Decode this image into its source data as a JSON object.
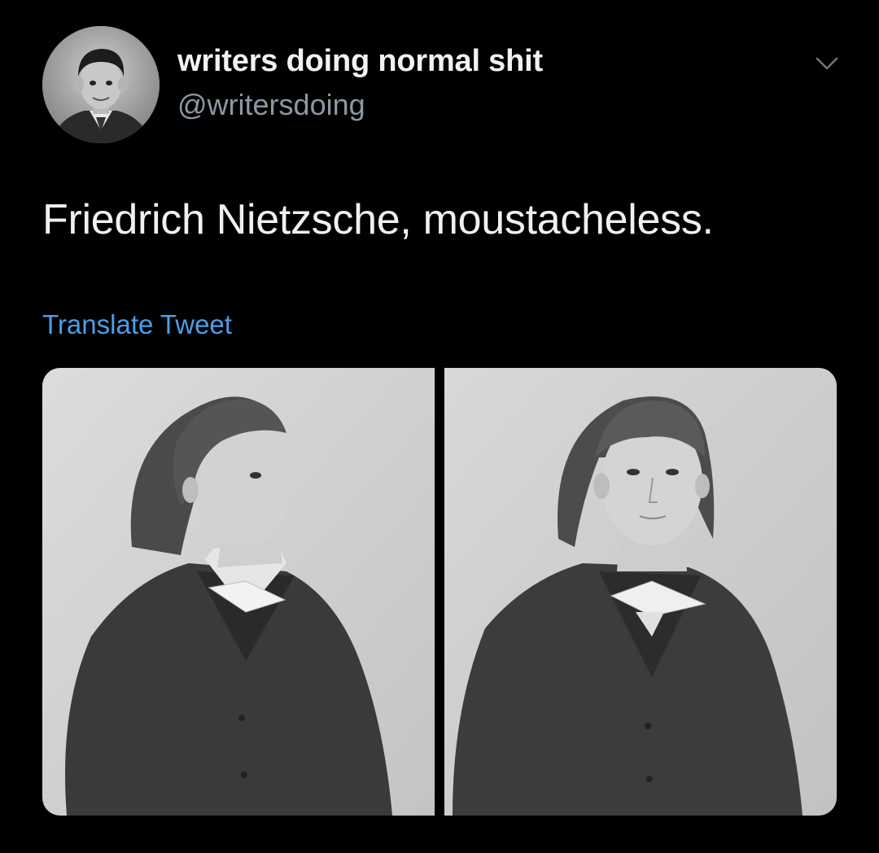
{
  "author": {
    "display_name": "writers doing normal shit",
    "handle": "@writersdoing",
    "avatar_icon": "avatar-photo"
  },
  "tweet": {
    "text": "Friedrich Nietzsche, moustacheless.",
    "translate_label": "Translate Tweet"
  },
  "media": [
    {
      "description_icon": "photo-portrait-profile"
    },
    {
      "description_icon": "photo-portrait-front"
    }
  ],
  "colors": {
    "background": "#000000",
    "text_primary": "#f0f0f0",
    "text_secondary": "#8b98a5",
    "link": "#4a9fe8"
  }
}
